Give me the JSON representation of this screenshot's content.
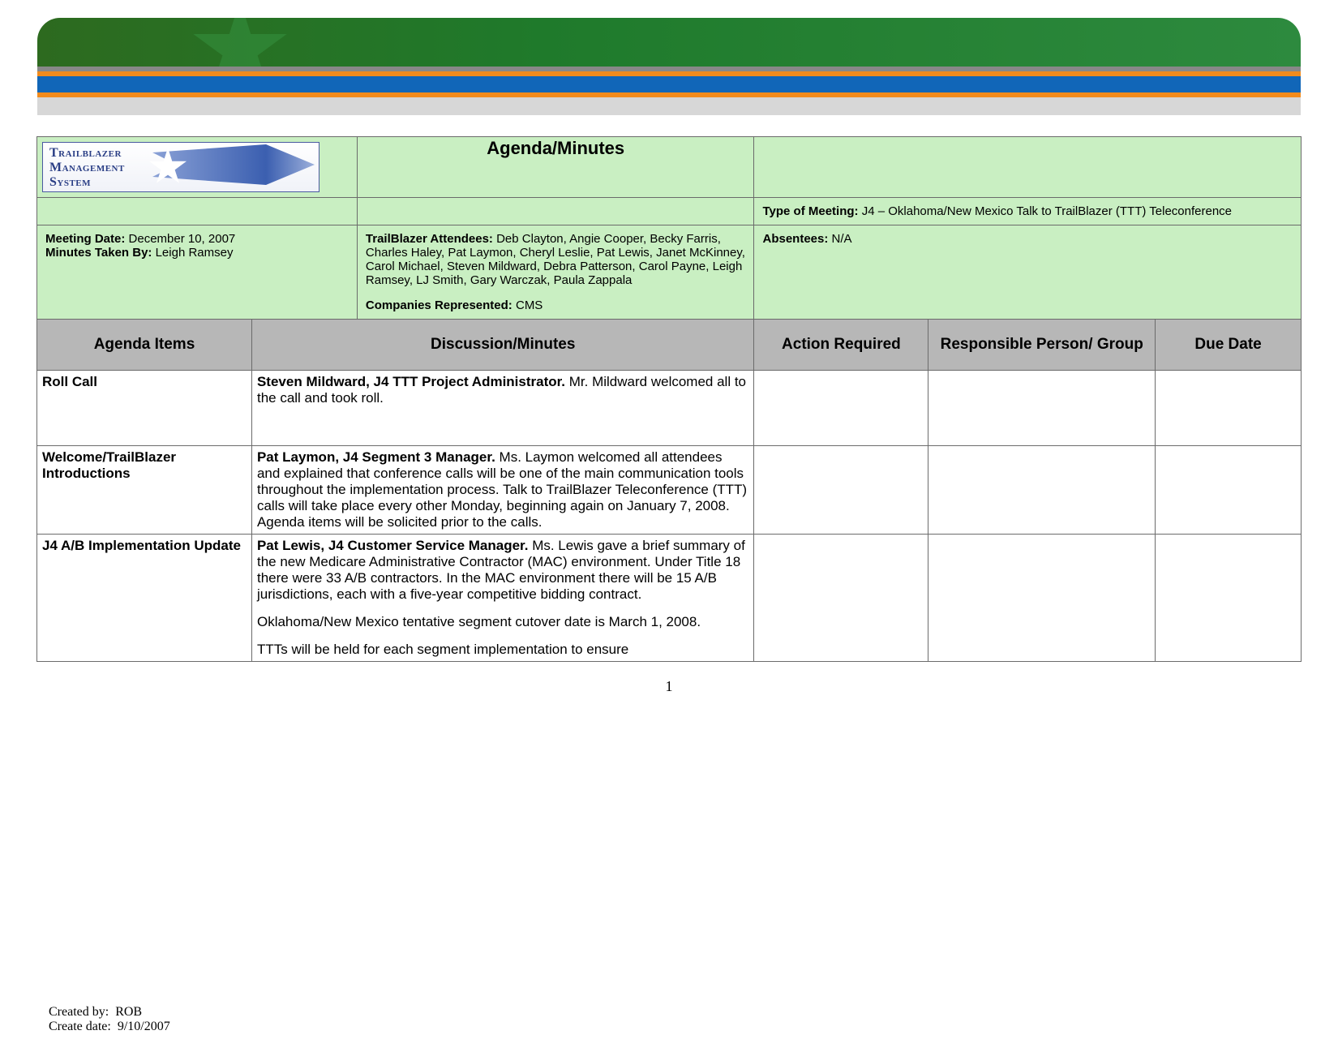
{
  "logo": {
    "line1": "Trailblazer",
    "line2": "Management",
    "line3": "System"
  },
  "header": {
    "title": "Agenda/Minutes",
    "meeting_date_label": "Meeting Date:",
    "meeting_date": "December 10, 2007",
    "minutes_by_label": "Minutes Taken By:",
    "minutes_by": "Leigh Ramsey",
    "attendees_label": "TrailBlazer Attendees:",
    "attendees": "Deb Clayton, Angie Cooper, Becky Farris, Charles Haley, Pat Laymon, Cheryl Leslie, Pat Lewis, Janet McKinney, Carol Michael, Steven Mildward, Debra Patterson, Carol Payne, Leigh Ramsey, LJ Smith, Gary Warczak, Paula Zappala",
    "companies_label": "Companies Represented:",
    "companies": "CMS",
    "type_label": "Type of Meeting:",
    "type": "J4 – Oklahoma/New Mexico Talk to TrailBlazer (TTT) Teleconference",
    "absentees_label": "Absentees:",
    "absentees": "N/A"
  },
  "columns": {
    "c1": "Agenda Items",
    "c2": "Discussion/Minutes",
    "c3": "Action Required",
    "c4": "Responsible Person/ Group",
    "c5": "Due Date"
  },
  "rows": [
    {
      "item": "Roll Call",
      "lead": "Steven Mildward, J4 TTT Project Administrator.",
      "paras": [
        "Mr. Mildward welcomed all to the call and took roll."
      ],
      "action": "",
      "resp": "",
      "due": ""
    },
    {
      "item": "Welcome/TrailBlazer Introductions",
      "lead": "Pat Laymon, J4 Segment 3 Manager.",
      "paras": [
        "Ms. Laymon welcomed all attendees and explained that conference calls will be one of the main communication tools throughout the implementation process. Talk to TrailBlazer Teleconference (TTT) calls will take place every other Monday, beginning again on January 7, 2008. Agenda items will be solicited prior to the calls."
      ],
      "action": "",
      "resp": "",
      "due": ""
    },
    {
      "item": "J4 A/B Implementation Update",
      "lead": "Pat Lewis, J4 Customer Service Manager.",
      "paras": [
        "Ms. Lewis gave a brief summary of the new Medicare Administrative Contractor (MAC) environment. Under Title 18 there were 33 A/B contractors. In the MAC environment there will be 15 A/B jurisdictions, each with a five-year competitive bidding contract.",
        "Oklahoma/New Mexico tentative segment cutover date is March 1, 2008.",
        "TTTs will be held for each segment implementation to ensure"
      ],
      "action": "",
      "resp": "",
      "due": ""
    }
  ],
  "page_number": "1",
  "footer": {
    "created_by_label": "Created by:",
    "created_by": "ROB",
    "create_date_label": "Create date:",
    "create_date": "9/10/2007"
  }
}
